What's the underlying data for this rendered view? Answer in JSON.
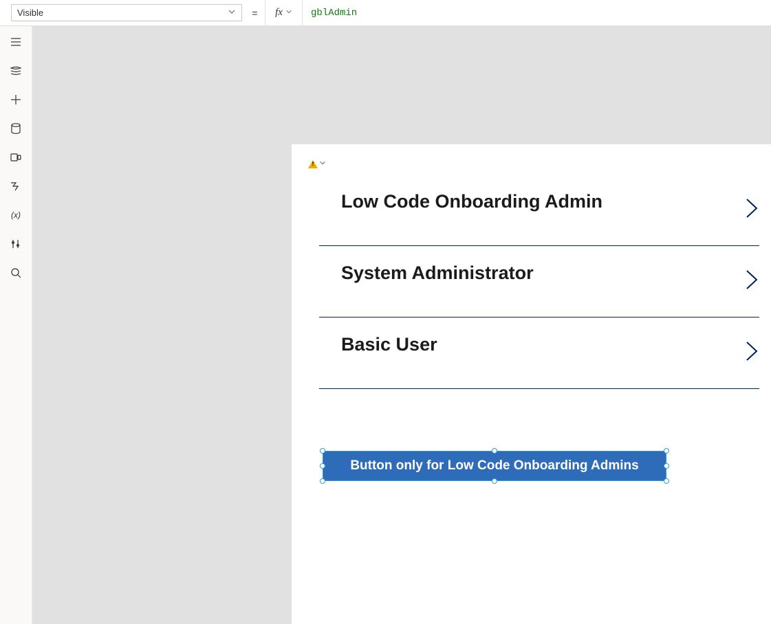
{
  "formula_bar": {
    "property": "Visible",
    "equals": "=",
    "fx_label": "fx",
    "value": "gblAdmin"
  },
  "gallery": {
    "items": [
      {
        "title": "Low Code Onboarding Admin"
      },
      {
        "title": "System Administrator"
      },
      {
        "title": "Basic User"
      }
    ]
  },
  "button": {
    "label": "Button only for Low Code Onboarding Admins"
  }
}
